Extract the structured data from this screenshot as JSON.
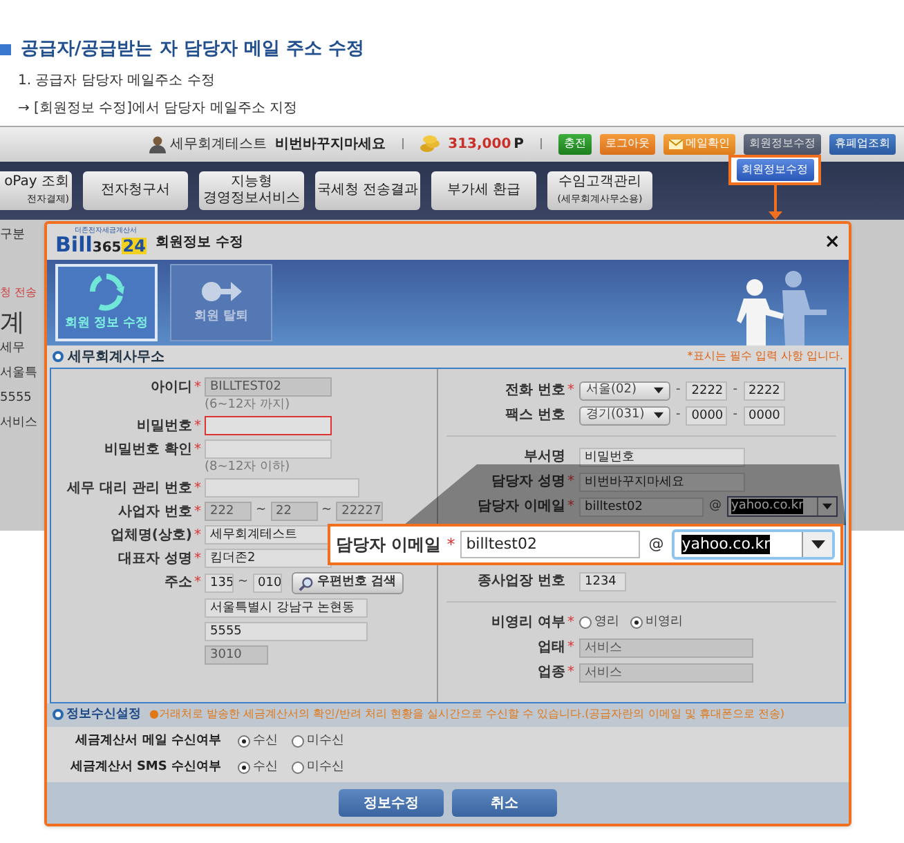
{
  "heading": "공급자/공급받는 자 담당자 메일 주소 수정",
  "steps": [
    "1. 공급자 담당자 메일주소 수정",
    "→ [회원정보 수정]에서 담당자 메일주소 지정"
  ],
  "site": {
    "user": "세무회계테스트",
    "greeting": "비번바꾸지마세요",
    "points": "313,000",
    "points_unit": "P",
    "buttons": [
      {
        "label": "충전",
        "kind": "charge"
      },
      {
        "label": "로그아웃",
        "kind": "logout"
      },
      {
        "label": "메일확인",
        "kind": "mail"
      },
      {
        "label": "회원정보수정",
        "kind": "member"
      },
      {
        "label": "휴폐업조회",
        "kind": "lookup"
      }
    ],
    "nav": [
      {
        "label": "oPay 조회",
        "sub": "전자결제)"
      },
      {
        "label": "전자청구서"
      },
      {
        "label": "지능형",
        "sub": "경영정보서비스"
      },
      {
        "label": "국세청 전송결과"
      },
      {
        "label": "부가세 환급"
      },
      {
        "label": "수임고객관리",
        "sub": "(세무회계사무소용)"
      }
    ],
    "background_texts": [
      {
        "text": "구분",
        "kind": "plain"
      },
      {
        "text": "청 전송",
        "kind": "alert"
      },
      {
        "text": "계",
        "kind": "large"
      },
      {
        "text": "세무",
        "kind": "plain"
      },
      {
        "text": "서울특",
        "kind": "plain"
      },
      {
        "text": "5555",
        "kind": "plain"
      },
      {
        "text": "서비스",
        "kind": "plain"
      }
    ]
  },
  "highlight_button": "회원정보수정",
  "dialog": {
    "logo_top": "더존전자세금계산서",
    "logo_main": "Bill",
    "logo_num": "365",
    "logo_24": "24",
    "title": "회원정보 수정",
    "close": "×",
    "tabs": [
      {
        "label": "회원 정보 수정",
        "selected": true,
        "kind": "edit"
      },
      {
        "label": "회원 탈퇴",
        "selected": false,
        "kind": "leave"
      }
    ],
    "section": "세무회계사무소",
    "required_note": "*표시는 필수 입력 사항 입니다.",
    "left_rows": [
      {
        "kind": "input",
        "label": "아이디",
        "required_mark": "*",
        "value": "BILLTEST02",
        "disabled": true,
        "hint": "(6~12자 까지)"
      },
      {
        "kind": "input",
        "label": "비밀번호",
        "required_mark": "*",
        "error": true
      },
      {
        "kind": "input",
        "label": "비밀번호 확인",
        "required_mark": "*",
        "hint": "(8~12자 이하)"
      },
      {
        "kind": "input",
        "label": "세무 대리 관리 번호",
        "required_mark": "*"
      },
      {
        "kind": "split",
        "label": "사업자 번호",
        "required_mark": "*",
        "parts": [
          "222",
          "22",
          "22227"
        ],
        "separator": "~",
        "disabled": true
      },
      {
        "kind": "input",
        "label": "업체명(상호)",
        "required_mark": "*",
        "value": "세무회계테스트"
      },
      {
        "kind": "input",
        "label": "대표자 성명",
        "required_mark": "*",
        "value": "킴더존2"
      },
      {
        "kind": "zip",
        "label": "주소",
        "required_mark": "*",
        "parts": [
          "135",
          "010"
        ],
        "separator": "~",
        "button": "우편번호 검색"
      },
      {
        "kind": "input",
        "value": "서울특별시 강남구 논현동"
      },
      {
        "kind": "input",
        "value": "5555"
      },
      {
        "kind": "input",
        "value": "3010",
        "disabled": true
      }
    ],
    "right_rows": [
      {
        "kind": "phone",
        "label": "전화 번호",
        "required_mark": "*",
        "area": "서울(02)",
        "parts": [
          "2222",
          "2222"
        ],
        "separator": "-"
      },
      {
        "kind": "phone",
        "label": "팩스 번호",
        "area": "경기(031)",
        "parts": [
          "0000",
          "0000"
        ],
        "separator": "-"
      },
      {
        "kind": "divider"
      },
      {
        "kind": "input",
        "label": "부서명",
        "value": "비밀번호"
      },
      {
        "kind": "input",
        "label": "담당자 성명",
        "required_mark": "*",
        "value": "비번바꾸지마세요"
      },
      {
        "kind": "email",
        "label": "담당자 이메일",
        "required_mark": "*",
        "value": "billtest02",
        "at": "@",
        "domain": "yahoo.co.kr"
      },
      {
        "kind": "input",
        "label": "종사업장 번호",
        "value": "1234"
      },
      {
        "kind": "divider"
      },
      {
        "kind": "radio",
        "label": "비영리 여부",
        "required_mark": "*",
        "options": [
          {
            "label": "영리",
            "selected": false
          },
          {
            "label": "비영리",
            "selected": true
          }
        ]
      },
      {
        "kind": "input",
        "label": "업태",
        "required_mark": "*",
        "value": "서비스",
        "disabled": true
      },
      {
        "kind": "input",
        "label": "업종",
        "required_mark": "*",
        "value": "서비스",
        "disabled": true
      }
    ],
    "info_title": "정보수신설정",
    "info_note": "●거래처로 발송한 세금계산서의 확인/반려 처리 현황을 실시간으로 수신할 수 있습니다.(공급자란의 이메일 및 휴대폰으로 전송)",
    "receive": [
      {
        "label": "세금계산서 메일 수신여부",
        "options": [
          {
            "label": "수신",
            "selected": true
          },
          {
            "label": "미수신",
            "selected": false
          }
        ]
      },
      {
        "label": "세금계산서 SMS 수신여부",
        "options": [
          {
            "label": "수신",
            "selected": true
          },
          {
            "label": "미수신",
            "selected": false
          }
        ]
      }
    ],
    "buttons": [
      "정보수정",
      "취소"
    ]
  },
  "callout": {
    "label": "담당자 이메일",
    "required_mark": "*",
    "value": "billtest02",
    "at": "@",
    "domain": "yahoo.co.kr"
  }
}
